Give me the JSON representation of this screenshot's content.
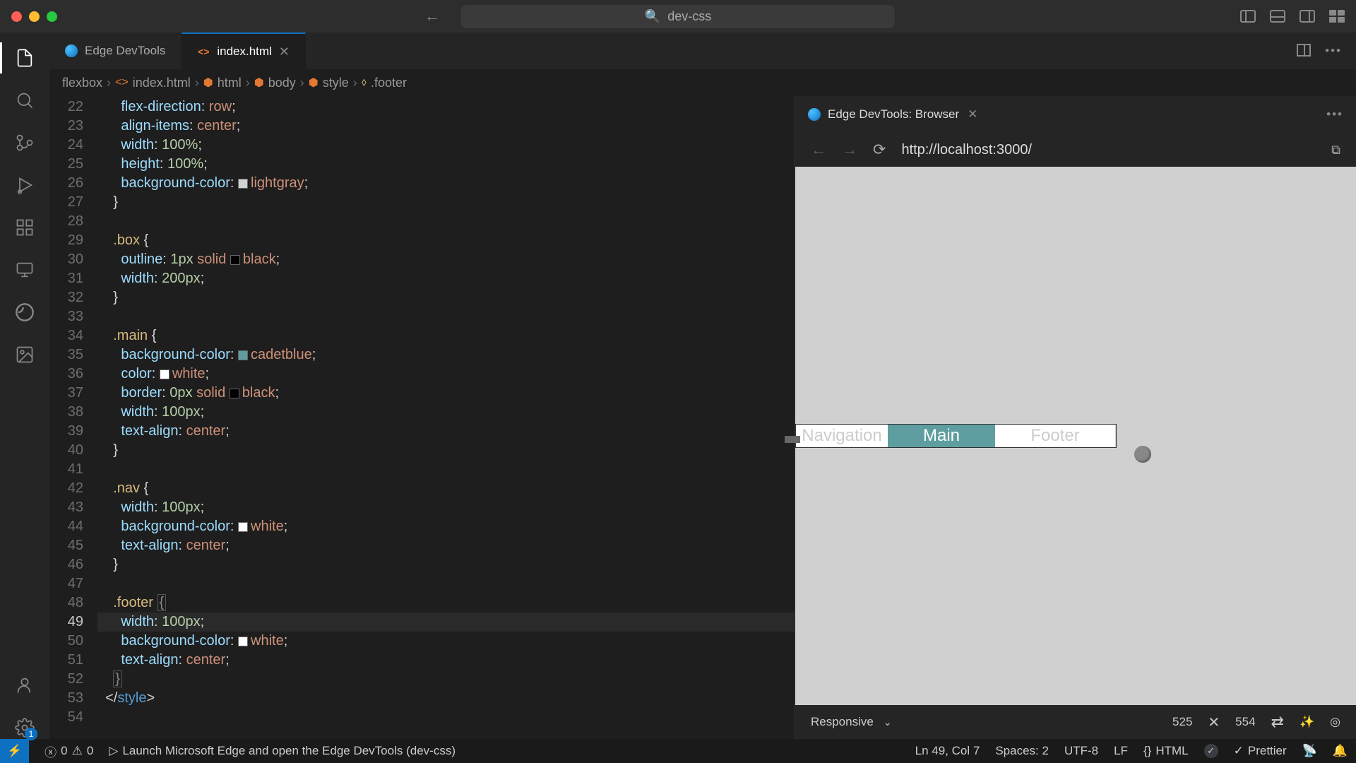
{
  "titlebar": {
    "project": "dev-css"
  },
  "tabs": {
    "items": [
      {
        "label": "Edge DevTools",
        "active": false,
        "kind": "edge"
      },
      {
        "label": "index.html",
        "active": true,
        "kind": "html"
      }
    ]
  },
  "breadcrumb": {
    "root": "flexbox",
    "file": "index.html",
    "path": [
      "html",
      "body",
      "style"
    ],
    "leaf": ".footer"
  },
  "code": {
    "first_line": 22,
    "lines": [
      {
        "n": 22,
        "html": "      <span class='tok-prop'>flex-direction</span><span class='tok-punc'>:</span> <span class='tok-val'>row</span><span class='tok-punc'>;</span>"
      },
      {
        "n": 23,
        "html": "      <span class='tok-prop'>align-items</span><span class='tok-punc'>:</span> <span class='tok-val'>center</span><span class='tok-punc'>;</span>"
      },
      {
        "n": 24,
        "html": "      <span class='tok-prop'>width</span><span class='tok-punc'>:</span> <span class='tok-num'>100%</span><span class='tok-punc'>;</span>"
      },
      {
        "n": 25,
        "html": "      <span class='tok-prop'>height</span><span class='tok-punc'>:</span> <span class='tok-num'>100%</span><span class='tok-punc'>;</span>"
      },
      {
        "n": 26,
        "html": "      <span class='tok-prop'>background-color</span><span class='tok-punc'>:</span> <span class='swatch' style='background:lightgray'></span><span class='tok-color'>lightgray</span><span class='tok-punc'>;</span>"
      },
      {
        "n": 27,
        "html": "    <span class='tok-punc'>}</span>"
      },
      {
        "n": 28,
        "html": ""
      },
      {
        "n": 29,
        "html": "    <span class='tok-sel'>.box</span> <span class='tok-punc'>{</span>"
      },
      {
        "n": 30,
        "html": "      <span class='tok-prop'>outline</span><span class='tok-punc'>:</span> <span class='tok-num'>1px</span> <span class='tok-kw'>solid</span> <span class='swatch' style='background:black'></span><span class='tok-color'>black</span><span class='tok-punc'>;</span>"
      },
      {
        "n": 31,
        "html": "      <span class='tok-prop'>width</span><span class='tok-punc'>:</span> <span class='tok-num'>200px</span><span class='tok-punc'>;</span>"
      },
      {
        "n": 32,
        "html": "    <span class='tok-punc'>}</span>"
      },
      {
        "n": 33,
        "html": ""
      },
      {
        "n": 34,
        "html": "    <span class='tok-sel'>.main</span> <span class='tok-punc'>{</span>"
      },
      {
        "n": 35,
        "html": "      <span class='tok-prop'>background-color</span><span class='tok-punc'>:</span> <span class='swatch' style='background:cadetblue'></span><span class='tok-color'>cadetblue</span><span class='tok-punc'>;</span>"
      },
      {
        "n": 36,
        "html": "      <span class='tok-prop'>color</span><span class='tok-punc'>:</span> <span class='swatch' style='background:white'></span><span class='tok-color'>white</span><span class='tok-punc'>;</span>"
      },
      {
        "n": 37,
        "html": "      <span class='tok-prop'>border</span><span class='tok-punc'>:</span> <span class='tok-num'>0px</span> <span class='tok-kw'>solid</span> <span class='swatch' style='background:black'></span><span class='tok-color'>black</span><span class='tok-punc'>;</span>"
      },
      {
        "n": 38,
        "html": "      <span class='tok-prop'>width</span><span class='tok-punc'>:</span> <span class='tok-num'>100px</span><span class='tok-punc'>;</span>"
      },
      {
        "n": 39,
        "html": "      <span class='tok-prop'>text-align</span><span class='tok-punc'>:</span> <span class='tok-val'>center</span><span class='tok-punc'>;</span>"
      },
      {
        "n": 40,
        "html": "    <span class='tok-punc'>}</span>"
      },
      {
        "n": 41,
        "html": ""
      },
      {
        "n": 42,
        "html": "    <span class='tok-sel'>.nav</span> <span class='tok-punc'>{</span>"
      },
      {
        "n": 43,
        "html": "      <span class='tok-prop'>width</span><span class='tok-punc'>:</span> <span class='tok-num'>100px</span><span class='tok-punc'>;</span>"
      },
      {
        "n": 44,
        "html": "      <span class='tok-prop'>background-color</span><span class='tok-punc'>:</span> <span class='swatch' style='background:white'></span><span class='tok-color'>white</span><span class='tok-punc'>;</span>"
      },
      {
        "n": 45,
        "html": "      <span class='tok-prop'>text-align</span><span class='tok-punc'>:</span> <span class='tok-val'>center</span><span class='tok-punc'>;</span>"
      },
      {
        "n": 46,
        "html": "    <span class='tok-punc'>}</span>"
      },
      {
        "n": 47,
        "html": ""
      },
      {
        "n": 48,
        "html": "    <span class='tok-sel'>.footer</span> <span class='fold-br'>{</span>"
      },
      {
        "n": 49,
        "html": "      <span class='tok-prop'>width</span><span class='tok-punc'>:</span> <span class='tok-num'>100px</span><span class='tok-punc'>;</span>",
        "hl": true
      },
      {
        "n": 50,
        "html": "      <span class='tok-prop'>background-color</span><span class='tok-punc'>:</span> <span class='swatch' style='background:white'></span><span class='tok-color'>white</span><span class='tok-punc'>;</span>"
      },
      {
        "n": 51,
        "html": "      <span class='tok-prop'>text-align</span><span class='tok-punc'>:</span> <span class='tok-val'>center</span><span class='tok-punc'>;</span>"
      },
      {
        "n": 52,
        "html": "    <span class='fold-br'>}</span>"
      },
      {
        "n": 53,
        "html": "  <span class='tok-punc'>&lt;/</span><span class='tok-tag'>style</span><span class='tok-punc'>&gt;</span>"
      },
      {
        "n": 54,
        "html": ""
      }
    ]
  },
  "browser": {
    "tab_label": "Edge DevTools: Browser",
    "url": "http://localhost:3000/",
    "viewport": {
      "mode": "Responsive",
      "w": "525",
      "h": "554"
    },
    "preview": {
      "nav": "Navigation",
      "main": "Main",
      "footer": "Footer"
    }
  },
  "status": {
    "errors": "0",
    "warnings": "0",
    "launch": "Launch Microsoft Edge and open the Edge DevTools (dev-css)",
    "cursor": "Ln 49, Col 7",
    "spaces": "Spaces: 2",
    "encoding": "UTF-8",
    "eol": "LF",
    "lang": "HTML",
    "prettier": "Prettier",
    "settings_badge": "1"
  }
}
